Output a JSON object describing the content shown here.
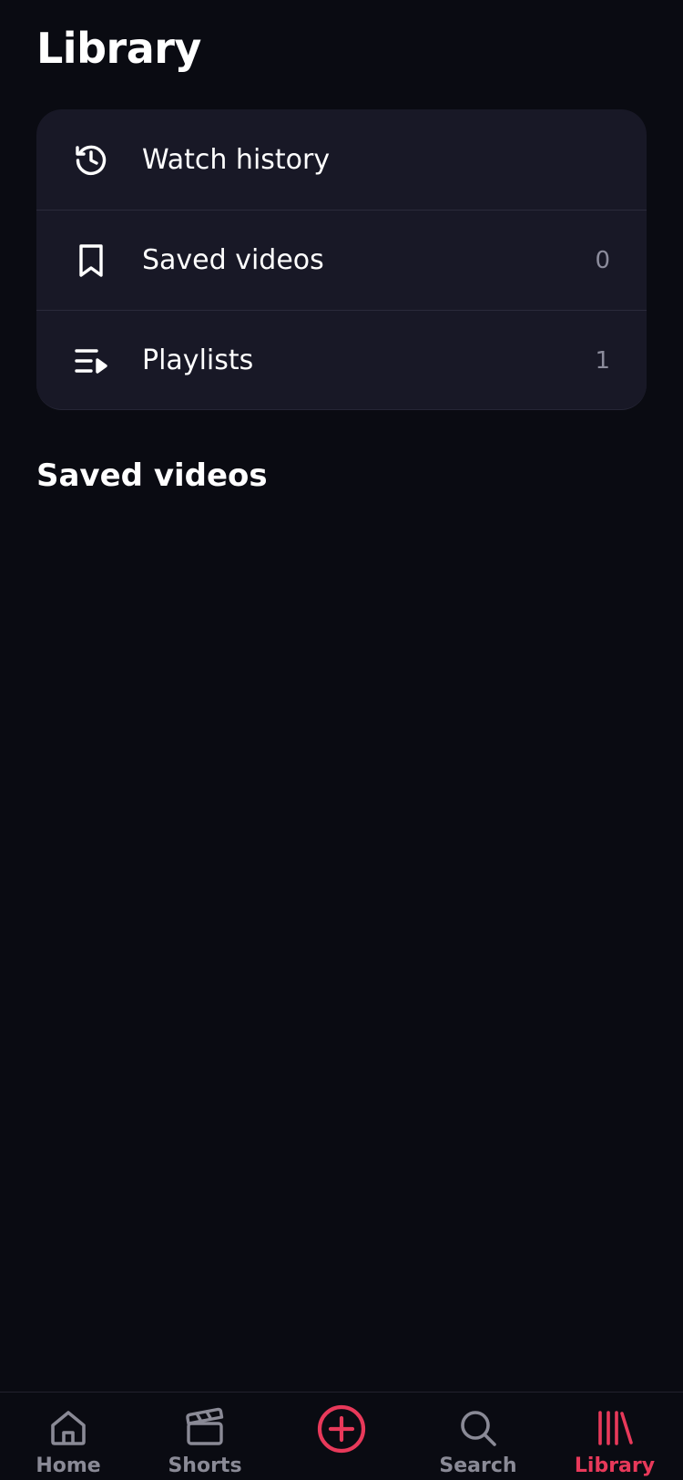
{
  "header": {
    "title": "Library"
  },
  "menu": {
    "items": [
      {
        "label": "Watch history",
        "count": "",
        "icon": "history-icon"
      },
      {
        "label": "Saved videos",
        "count": "0",
        "icon": "bookmark-icon"
      },
      {
        "label": "Playlists",
        "count": "1",
        "icon": "playlist-icon"
      }
    ]
  },
  "section": {
    "title": "Saved videos"
  },
  "bottom_nav": {
    "items": [
      {
        "label": "Home",
        "icon": "home-icon"
      },
      {
        "label": "Shorts",
        "icon": "clapperboard-icon"
      },
      {
        "label": "",
        "icon": "create-plus-icon"
      },
      {
        "label": "Search",
        "icon": "search-icon"
      },
      {
        "label": "Library",
        "icon": "library-icon"
      }
    ],
    "active": "Library"
  },
  "colors": {
    "background": "#0a0b12",
    "card": "#181826",
    "accent": "#e8395a",
    "inactive": "#8a8a96",
    "count_text": "#8c8c9c"
  }
}
